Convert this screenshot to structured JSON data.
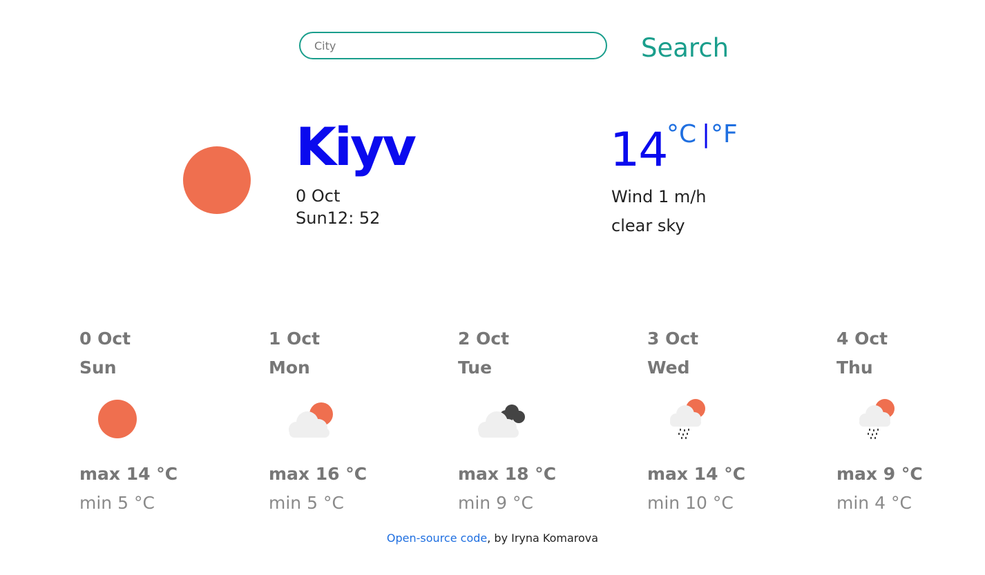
{
  "search": {
    "placeholder": "City",
    "button_label": "Search"
  },
  "current": {
    "city": "Kiyv",
    "date": "0 Oct",
    "time": "Sun12: 52",
    "temperature": "14",
    "unit_celsius": "°C",
    "unit_separator": "|",
    "unit_fahrenheit": "°F",
    "wind": "Wind 1 m/h",
    "description": "clear sky",
    "icon": "sun-icon"
  },
  "forecast": [
    {
      "date": "0 Oct",
      "day": "Sun",
      "max": "max 14 °C",
      "min": "min 5 °C",
      "icon": "sun-icon"
    },
    {
      "date": "1 Oct",
      "day": "Mon",
      "max": "max 16 °C",
      "min": "min 5 °C",
      "icon": "partly-cloudy-icon"
    },
    {
      "date": "2 Oct",
      "day": "Tue",
      "max": "max 18 °C",
      "min": "min 9 °C",
      "icon": "cloudy-icon"
    },
    {
      "date": "3 Oct",
      "day": "Wed",
      "max": "max 14 °C",
      "min": "min 10 °C",
      "icon": "rain-sun-icon"
    },
    {
      "date": "4 Oct",
      "day": "Thu",
      "max": "max 9 °C",
      "min": "min 4 °C",
      "icon": "rain-sun-icon"
    }
  ],
  "footer": {
    "link_text": "Open-source code",
    "suffix": ", by Iryna Komarova"
  },
  "colors": {
    "accent": "#1a9e8c",
    "sun": "#ef6f4f",
    "city": "#0a0aee",
    "link": "#1f6fe0",
    "muted": "#777777"
  }
}
